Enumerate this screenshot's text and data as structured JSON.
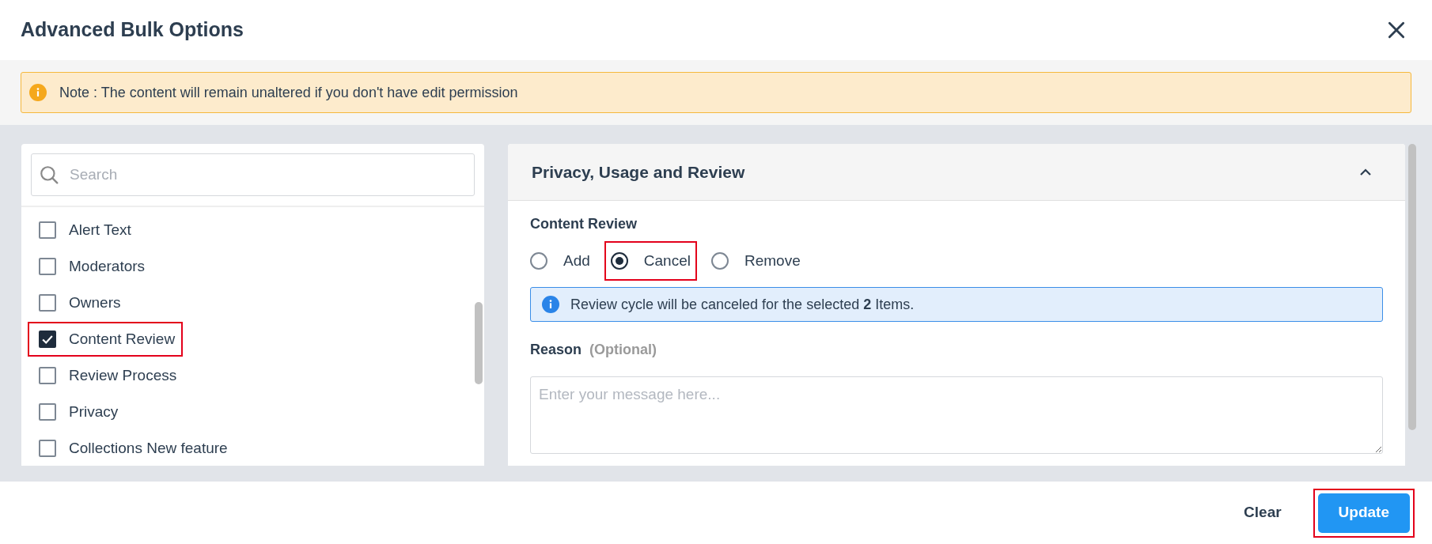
{
  "dialog": {
    "title": "Advanced Bulk Options"
  },
  "note": {
    "text": "Note : The content will remain unaltered if you don't have edit permission"
  },
  "field_list": {
    "search": {
      "placeholder": "Search"
    },
    "items": [
      {
        "label": "Alert Text",
        "checked": false,
        "highlighted": false
      },
      {
        "label": "Moderators",
        "checked": false,
        "highlighted": false
      },
      {
        "label": "Owners",
        "checked": false,
        "highlighted": false
      },
      {
        "label": "Content Review",
        "checked": true,
        "highlighted": true
      },
      {
        "label": "Review Process",
        "checked": false,
        "highlighted": false
      },
      {
        "label": "Privacy",
        "checked": false,
        "highlighted": false
      },
      {
        "label": "Collections New feature",
        "checked": false,
        "highlighted": false
      }
    ]
  },
  "section": {
    "title": "Privacy, Usage and Review",
    "expanded": true,
    "content_review": {
      "label": "Content Review",
      "options": [
        {
          "label": "Add",
          "selected": false,
          "highlighted": false
        },
        {
          "label": "Cancel",
          "selected": true,
          "highlighted": true
        },
        {
          "label": "Remove",
          "selected": false,
          "highlighted": false
        }
      ],
      "info": "Review cycle will be canceled for the selected **2** Items."
    },
    "reason": {
      "label": "Reason",
      "hint": "(Optional)",
      "placeholder": "Enter your message here..."
    }
  },
  "footer": {
    "buttons": [
      {
        "label": "Clear",
        "kind": "secondary",
        "highlighted": false
      },
      {
        "label": "Update",
        "kind": "primary",
        "highlighted": true
      }
    ]
  }
}
